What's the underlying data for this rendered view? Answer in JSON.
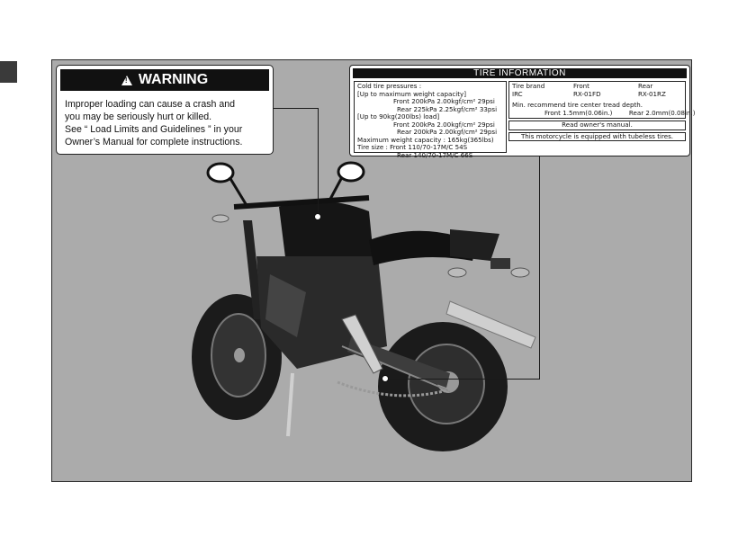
{
  "warning": {
    "title": "WARNING",
    "lines": [
      "Improper loading can cause a crash and",
      "you may be seriously hurt or killed.",
      "See “ Load Limits and Guidelines ” in your",
      "Owner’s Manual for complete instructions."
    ]
  },
  "tire_info": {
    "title": "TIRE  INFORMATION",
    "left": {
      "cold_title": "Cold  tire  pressures :",
      "max_title": "[Up  to  maximum  weight  capacity]",
      "max_front": "Front  200kPa  2.00kgf/cm²  29psi",
      "max_rear": "Rear  225kPa  2.25kgf/cm²  33psi",
      "light_title": "[Up  to  90kg(200lbs)  load]",
      "light_front": "Front  200kPa  2.00kgf/cm²  29psi",
      "light_rear": "Rear  200kPa  2.00kgf/cm²  29psi",
      "max_capacity": "Maximum  weight  capacity : 165kg(365lbs)",
      "size_label": "Tire  size :",
      "size_front": "Front  110/70-17M/C  54S",
      "size_rear": "Rear  140/70-17M/C  66S"
    },
    "right": {
      "brand_label": "Tire  brand",
      "front_label": "Front",
      "rear_label": "Rear",
      "brand": "IRC",
      "front_model": "RX-01FD",
      "rear_model": "RX-01RZ",
      "tread_title": "Min.  recommend  tire  center  tread  depth.",
      "tread_front": "Front  1.5mm(0.06in.)",
      "tread_rear": "Rear  2.0mm(0.08in.)",
      "note_manual": "Read  owner's  manual.",
      "note_tubeless": "This  motorcycle  is  equipped  with  tubeless  tires."
    }
  },
  "colors": {
    "panel": "#ababab",
    "label_fill": "#ffffff",
    "ink": "#111111"
  },
  "icons": [
    "warning-triangle-icon"
  ]
}
